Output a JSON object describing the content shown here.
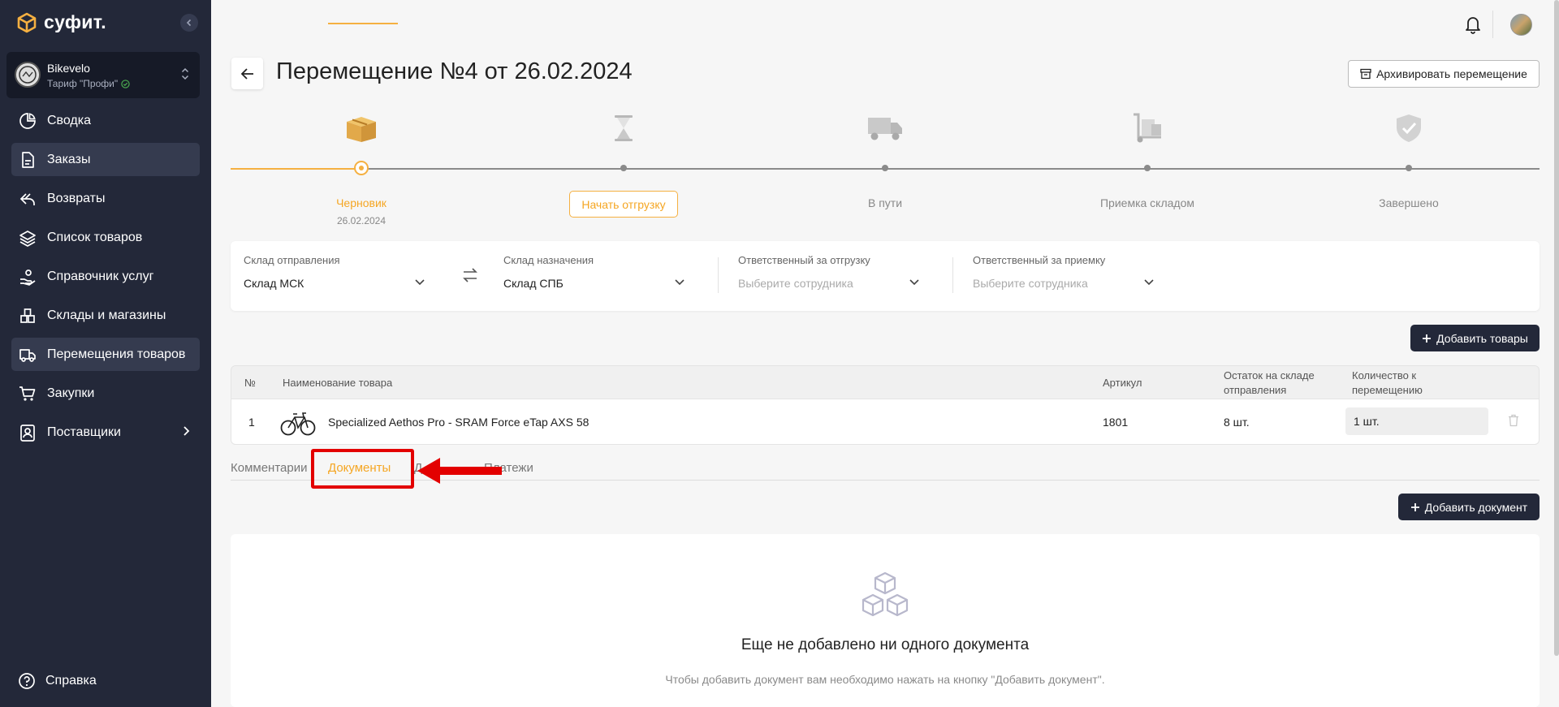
{
  "brand": {
    "name": "суфит."
  },
  "account": {
    "name": "Bikevelo",
    "plan": "Тариф \"Профи\""
  },
  "nav": {
    "items": [
      {
        "label": "Сводка"
      },
      {
        "label": "Заказы"
      },
      {
        "label": "Возвраты"
      },
      {
        "label": "Список товаров"
      },
      {
        "label": "Справочник услуг"
      },
      {
        "label": "Склады и магазины"
      },
      {
        "label": "Перемещения товаров"
      },
      {
        "label": "Закупки"
      },
      {
        "label": "Поставщики"
      }
    ],
    "help": "Справка"
  },
  "header": {
    "title": "Перемещение №4 от 26.02.2024",
    "archive_label": "Архивировать перемещение"
  },
  "progress": {
    "current_step": 1,
    "steps": [
      {
        "label": "Черновик",
        "date": "26.02.2024"
      },
      {
        "label": "Начать отгрузку"
      },
      {
        "label": "В пути"
      },
      {
        "label": "Приемка складом"
      },
      {
        "label": "Завершено"
      }
    ]
  },
  "warehouses": {
    "from_label": "Склад отправления",
    "from_value": "Склад МСК",
    "to_label": "Склад назначения",
    "to_value": "Склад СПБ",
    "ship_resp_label": "Ответственный за отгрузку",
    "ship_resp_placeholder": "Выберите сотрудника",
    "recv_resp_label": "Ответственный за приемку",
    "recv_resp_placeholder": "Выберите сотрудника"
  },
  "add_goods_label": "Добавить товары",
  "table": {
    "headers": {
      "num": "№",
      "name": "Наименование товара",
      "sku": "Артикул",
      "stock_1": "Остаток на складе",
      "stock_2": "отправления",
      "qty_1": "Количество к",
      "qty_2": "перемещению"
    },
    "rows": [
      {
        "num": "1",
        "name": "Specialized Aethos Pro - SRAM Force eTap AXS 58",
        "sku": "1801",
        "stock": "8 шт.",
        "qty": "1 шт."
      }
    ]
  },
  "tabs": {
    "items": [
      {
        "label": "Комментарии"
      },
      {
        "label": "Документы"
      },
      {
        "label": "Д"
      },
      {
        "label": "Платежи"
      }
    ],
    "active": 1
  },
  "add_doc_label": "Добавить документ",
  "documents": {
    "empty_title": "Еще не добавлено ни одного документа",
    "empty_sub": "Чтобы добавить документ вам необходимо нажать на кнопку \"Добавить документ\"."
  },
  "colors": {
    "sidebar": "#232839",
    "accent": "#f5b041",
    "annotation": "#e30000"
  }
}
